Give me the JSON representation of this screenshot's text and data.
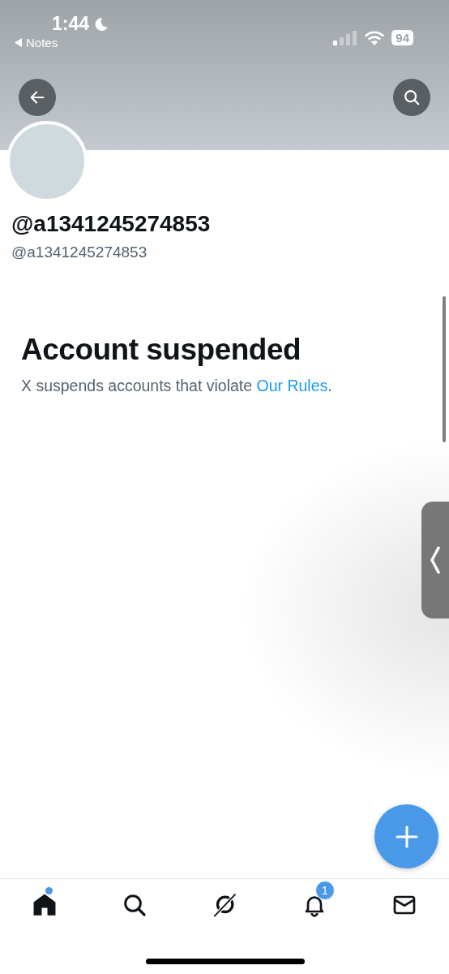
{
  "status_bar": {
    "time": "1:44",
    "back_app": "Notes",
    "battery": "94"
  },
  "profile": {
    "display_name": "@a1341245274853",
    "handle": "@a1341245274853"
  },
  "notice": {
    "title": "Account suspended",
    "text": "X suspends accounts that violate ",
    "link": "Our Rules",
    "end": "."
  },
  "tabs": [
    {
      "kind": "home",
      "selected": true
    },
    {
      "kind": "search",
      "selected": false
    },
    {
      "kind": "grok",
      "selected": false
    },
    {
      "kind": "notifications",
      "selected": false,
      "badge": "1"
    },
    {
      "kind": "messages",
      "selected": false
    }
  ]
}
